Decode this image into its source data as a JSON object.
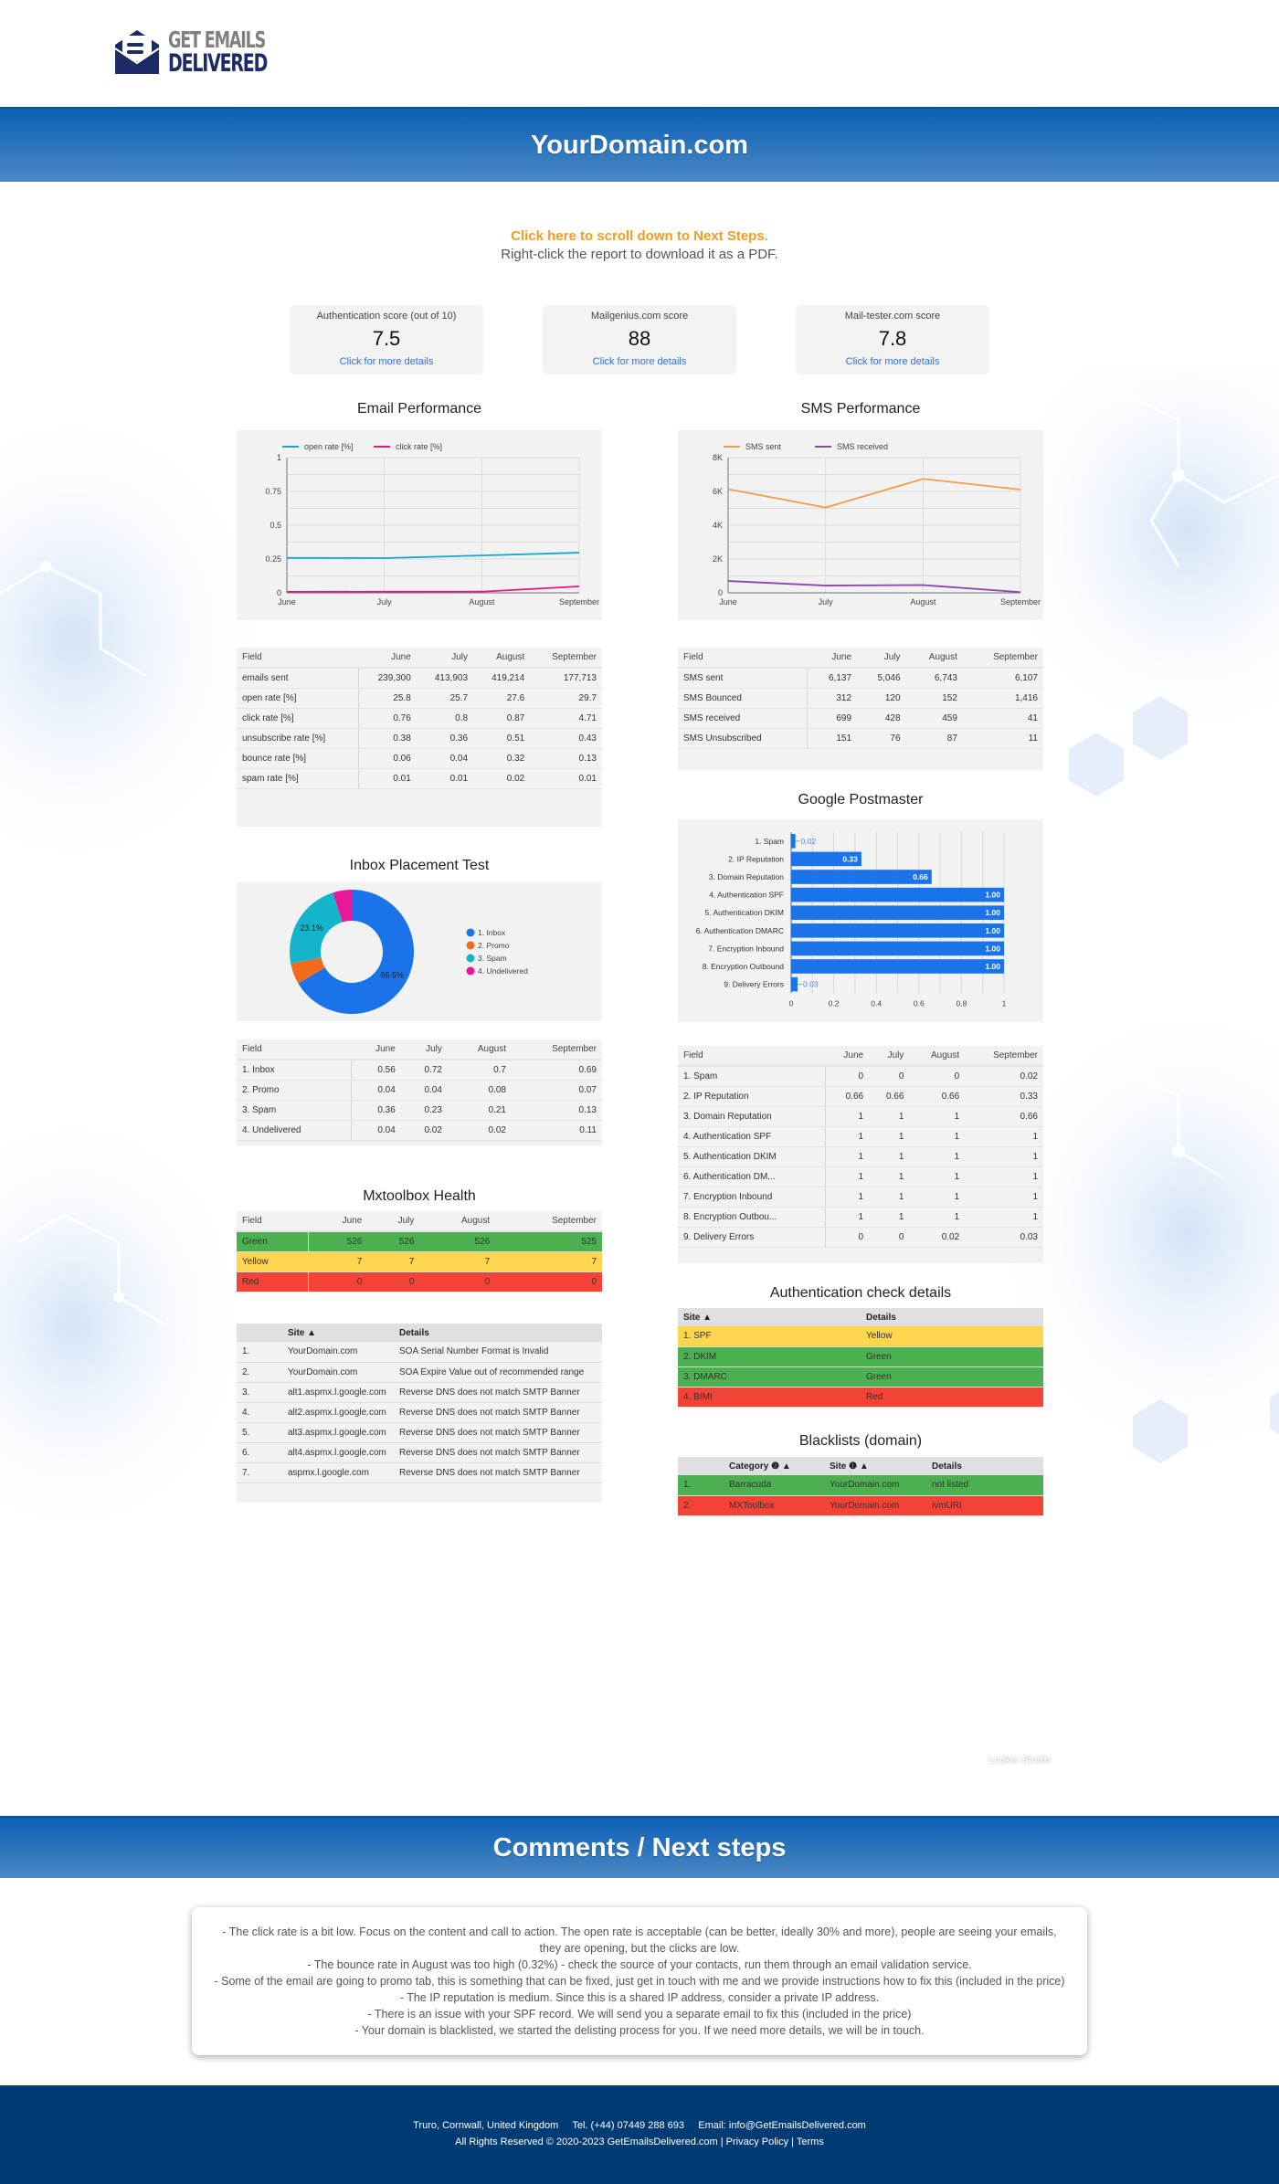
{
  "brand": {
    "line1": "GET EMAILS",
    "line2": "DELIVERED"
  },
  "header": {
    "title": "YourDomain.com"
  },
  "intro": {
    "scroll_link": "Click here to scroll down to Next Steps.",
    "pdf_hint": "Right-click the report to download it as a PDF."
  },
  "scores": [
    {
      "label": "Authentication score (out of 10)",
      "value": "7.5",
      "link": "Click for more details"
    },
    {
      "label": "Mailgenius.com score",
      "value": "88",
      "link": "Click for more details"
    },
    {
      "label": "Mail-tester.com score",
      "value": "7.8",
      "link": "Click for more details"
    }
  ],
  "colors": {
    "green": "#4caf50",
    "yellow": "#fdd54f",
    "red": "#f44336",
    "bar_blue": "#1a73e8",
    "band_blue": "#0c5fb4",
    "footer_blue": "#003b74",
    "accent_orange": "#f79a1e"
  },
  "email_table": {
    "headers": [
      "Field",
      "June",
      "July",
      "August",
      "September"
    ],
    "rows": [
      [
        "emails sent",
        "239,300",
        "413,903",
        "419,214",
        "177,713"
      ],
      [
        "open rate [%]",
        "25.8",
        "25.7",
        "27.6",
        "29.7"
      ],
      [
        "click rate [%]",
        "0.76",
        "0.8",
        "0.87",
        "4.71"
      ],
      [
        "unsubscribe rate [%]",
        "0.38",
        "0.36",
        "0.51",
        "0.43"
      ],
      [
        "bounce rate [%]",
        "0.06",
        "0.04",
        "0.32",
        "0.13"
      ],
      [
        "spam rate [%]",
        "0.01",
        "0.01",
        "0.02",
        "0.01"
      ]
    ]
  },
  "sms_table": {
    "headers": [
      "Field",
      "June",
      "July",
      "August",
      "September"
    ],
    "rows": [
      [
        "SMS sent",
        "6,137",
        "5,046",
        "6,743",
        "6,107"
      ],
      [
        "SMS Bounced",
        "312",
        "120",
        "152",
        "1,416"
      ],
      [
        "SMS received",
        "699",
        "428",
        "459",
        "41"
      ],
      [
        "SMS Unsubscribed",
        "151",
        "76",
        "87",
        "11"
      ]
    ]
  },
  "inbox_table": {
    "headers": [
      "Field",
      "June",
      "July",
      "August",
      "September"
    ],
    "rows": [
      [
        "1. Inbox",
        "0.56",
        "0.72",
        "0.7",
        "0.69"
      ],
      [
        "2. Promo",
        "0.04",
        "0.04",
        "0.08",
        "0.07"
      ],
      [
        "3. Spam",
        "0.36",
        "0.23",
        "0.21",
        "0.13"
      ],
      [
        "4. Undelivered",
        "0.04",
        "0.02",
        "0.02",
        "0.11"
      ]
    ]
  },
  "postmaster_table": {
    "headers": [
      "Field",
      "June",
      "July",
      "August",
      "September"
    ],
    "rows": [
      [
        "1. Spam",
        "0",
        "0",
        "0",
        "0.02"
      ],
      [
        "2. IP Reputation",
        "0.66",
        "0.66",
        "0.66",
        "0.33"
      ],
      [
        "3. Domain Reputation",
        "1",
        "1",
        "1",
        "0.66"
      ],
      [
        "4. Authentication SPF",
        "1",
        "1",
        "1",
        "1"
      ],
      [
        "5. Authentication DKIM",
        "1",
        "1",
        "1",
        "1"
      ],
      [
        "6. Authentication DM...",
        "1",
        "1",
        "1",
        "1"
      ],
      [
        "7. Encryption Inbound",
        "1",
        "1",
        "1",
        "1"
      ],
      [
        "8. Encryption Outbou...",
        "1",
        "1",
        "1",
        "1"
      ],
      [
        "9. Delivery Errors",
        "0",
        "0",
        "0.02",
        "0.03"
      ]
    ]
  },
  "mxtoolbox": {
    "title": "Mxtoolbox Health",
    "headers": [
      "Field",
      "June",
      "July",
      "August",
      "September"
    ],
    "rows": [
      {
        "status": "green",
        "cells": [
          "Green",
          "526",
          "526",
          "526",
          "525"
        ]
      },
      {
        "status": "yellow",
        "cells": [
          "Yellow",
          "7",
          "7",
          "7",
          "7"
        ]
      },
      {
        "status": "red",
        "cells": [
          "Red",
          "0",
          "0",
          "0",
          "0"
        ]
      }
    ]
  },
  "mx_issues": {
    "headers": [
      "",
      "Site ▲",
      "Details"
    ],
    "rows": [
      [
        "1.",
        "YourDomain.com",
        "SOA Serial Number Format is Invalid"
      ],
      [
        "2.",
        "YourDomain.com",
        "SOA Expire Value out of recommended range"
      ],
      [
        "3.",
        "alt1.aspmx.l.google.com",
        "Reverse DNS does not match SMTP Banner"
      ],
      [
        "4.",
        "alt2.aspmx.l.google.com",
        "Reverse DNS does not match SMTP Banner"
      ],
      [
        "5.",
        "alt3.aspmx.l.google.com",
        "Reverse DNS does not match SMTP Banner"
      ],
      [
        "6.",
        "alt4.aspmx.l.google.com",
        "Reverse DNS does not match SMTP Banner"
      ],
      [
        "7.",
        "aspmx.l.google.com",
        "Reverse DNS does not match SMTP Banner"
      ]
    ]
  },
  "auth_check": {
    "title": "Authentication check details",
    "headers": [
      "Site ▲",
      "Details"
    ],
    "rows": [
      {
        "status": "yellow",
        "cells": [
          "1. SPF",
          "Yellow"
        ]
      },
      {
        "status": "green",
        "cells": [
          "2. DKIM",
          "Green"
        ]
      },
      {
        "status": "green",
        "cells": [
          "3. DMARC",
          "Green"
        ]
      },
      {
        "status": "red",
        "cells": [
          "4. BIMI",
          "Red"
        ]
      }
    ]
  },
  "blacklists": {
    "title": "Blacklists (domain)",
    "headers": [
      "",
      "Category ❷ ▲",
      "Site ❶ ▲",
      "Details"
    ],
    "rows": [
      {
        "status": "green",
        "cells": [
          "1.",
          "Barracuda",
          "YourDomain.com",
          "not listed"
        ]
      },
      {
        "status": "red",
        "cells": [
          "2.",
          "MXToolbox",
          "YourDomain.com",
          "ivmURI"
        ]
      }
    ]
  },
  "chart_data": [
    {
      "type": "line",
      "title": "Email Performance",
      "x": [
        "June",
        "July",
        "August",
        "September"
      ],
      "series": [
        {
          "name": "open rate [%]",
          "color": "#12a8c8",
          "values": [
            0.258,
            0.257,
            0.276,
            0.297
          ]
        },
        {
          "name": "click rate [%]",
          "color": "#e8177d",
          "values": [
            0.0076,
            0.008,
            0.0087,
            0.0471
          ]
        }
      ],
      "ylim": [
        0,
        1
      ],
      "yticks": [
        "0",
        "0.25",
        "0.5",
        "0.75",
        "1"
      ],
      "grid": true,
      "legend": "top-left"
    },
    {
      "type": "line",
      "title": "SMS Performance",
      "x": [
        "June",
        "July",
        "August",
        "September"
      ],
      "series": [
        {
          "name": "SMS sent",
          "color": "#f59c4a",
          "values": [
            6137,
            5046,
            6743,
            6107
          ]
        },
        {
          "name": "SMS received",
          "color": "#8e44ad",
          "values": [
            699,
            428,
            459,
            41
          ]
        }
      ],
      "ylim": [
        0,
        8000
      ],
      "yticks": [
        "0",
        "2K",
        "4K",
        "6K",
        "8K"
      ],
      "grid": true,
      "legend": "top-left"
    },
    {
      "type": "pie",
      "title": "Inbox Placement Test",
      "donut": true,
      "slices": [
        {
          "label": "1. Inbox",
          "value": 66.5,
          "color": "#1a73e8",
          "data_label": "66.5%"
        },
        {
          "label": "2. Promo",
          "value": 5.5,
          "color": "#f26b1d",
          "data_label": ""
        },
        {
          "label": "3. Spam",
          "value": 23.1,
          "color": "#12b5cb",
          "data_label": "23.1%"
        },
        {
          "label": "4. Undelivered",
          "value": 4.9,
          "color": "#e8179a",
          "data_label": ""
        }
      ],
      "legend": "right"
    },
    {
      "type": "bar",
      "orientation": "horizontal",
      "title": "Google Postmaster",
      "categories": [
        "1. Spam",
        "2. IP Reputation",
        "3. Domain Reputation",
        "4. Authentication SPF",
        "5. Authentication DKIM",
        "6. Authentication DMARC",
        "7. Encryption Inbound",
        "8. Encryption Outbound",
        "9. Delivery Errors"
      ],
      "values": [
        0.02,
        0.33,
        0.66,
        1.0,
        1.0,
        1.0,
        1.0,
        1.0,
        0.03
      ],
      "data_labels": [
        "0.02",
        "0.33",
        "0.66",
        "1.00",
        "1.00",
        "1.00",
        "1.00",
        "1.00",
        "0.03"
      ],
      "xlim": [
        0,
        1
      ],
      "xticks": [
        "0",
        "0.2",
        "0.4",
        "0.6",
        "0.8",
        "1"
      ],
      "color": "#1a73e8",
      "grid": true
    }
  ],
  "comments": {
    "title": "Comments / Next steps",
    "lines": [
      "- The click rate is a bit low. Focus on the content and call to action. The open rate is acceptable (can be better, ideally 30% and more), people are seeing your emails, they are opening, but the clicks are low.",
      "- The bounce rate in August was too high (0.32%) - check the source of your contacts, run them through an email validation service.",
      "- Some of the email are going to promo tab, this is something that can be fixed, just get in touch with me and we provide instructions how to fix this (included in the price)",
      "- The IP reputation is medium. Since this is a shared IP address, consider a private IP address.",
      "- There is an issue with your SPF record. We will send you a separate email to fix this (included in the price)",
      "- Your domain is blacklisted, we started the delisting process for you. If we need more details, we will be in touch."
    ]
  },
  "watermark": "Looker Studio",
  "footer": {
    "location": "Truro, Cornwall, United Kingdom",
    "tel": "Tel. (+44) 07449 288 693",
    "email_label": "Email:",
    "email": "info@GetEmailsDelivered.com",
    "rights": "All Rights Reserved © 2020-2023 GetEmailsDelivered.com",
    "privacy": "Privacy Policy",
    "terms": "Terms"
  }
}
